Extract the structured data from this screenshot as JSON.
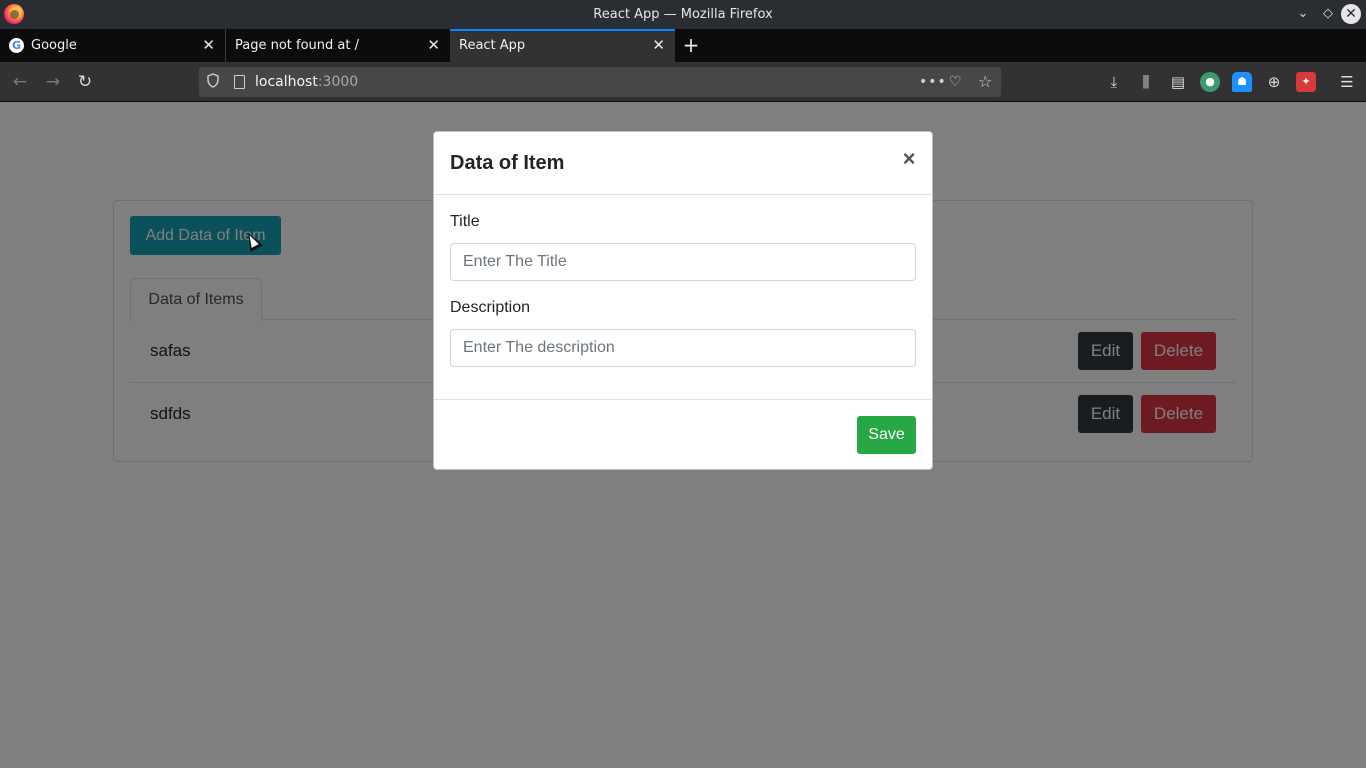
{
  "window": {
    "title": "React App — Mozilla Firefox",
    "min_glyph": "⌄",
    "max_glyph": "◇",
    "close_glyph": "✕"
  },
  "tabs": [
    {
      "label": "Google",
      "favicon": "G",
      "active": false
    },
    {
      "label": "Page not found at /",
      "active": false
    },
    {
      "label": "React App",
      "active": true
    }
  ],
  "tab_close_glyph": "✕",
  "new_tab_glyph": "+",
  "toolbar": {
    "back_glyph": "←",
    "forward_glyph": "→",
    "reload_glyph": "↻",
    "url_host": "localhost",
    "url_port": ":3000",
    "more_glyph": "•••",
    "pocket_glyph": "♡",
    "star_glyph": "☆",
    "download_glyph": "⤓",
    "library_glyph": "⫼",
    "sidebar_glyph": "▤",
    "ext1_glyph": "●",
    "ext2_glyph": "☗",
    "ext3_glyph": "⊕",
    "ext4_glyph": "✦",
    "menu_glyph": "☰"
  },
  "page": {
    "add_button_label": "Add Data of Item",
    "tab_label": "Data of Items",
    "items": [
      {
        "name": "safas",
        "edit_label": "Edit",
        "delete_label": "Delete"
      },
      {
        "name": "sdfds",
        "edit_label": "Edit",
        "delete_label": "Delete"
      }
    ]
  },
  "modal": {
    "title": "Data of Item",
    "close_glyph": "×",
    "title_label": "Title",
    "title_placeholder": "Enter The Title",
    "title_value": "",
    "description_label": "Description",
    "description_placeholder": "Enter The description",
    "description_value": "",
    "save_label": "Save"
  },
  "colors": {
    "primary_info": "#17a2b8",
    "dark": "#343a40",
    "danger": "#dc3545",
    "success": "#28a745",
    "firefox_accent": "#0a84ff"
  }
}
